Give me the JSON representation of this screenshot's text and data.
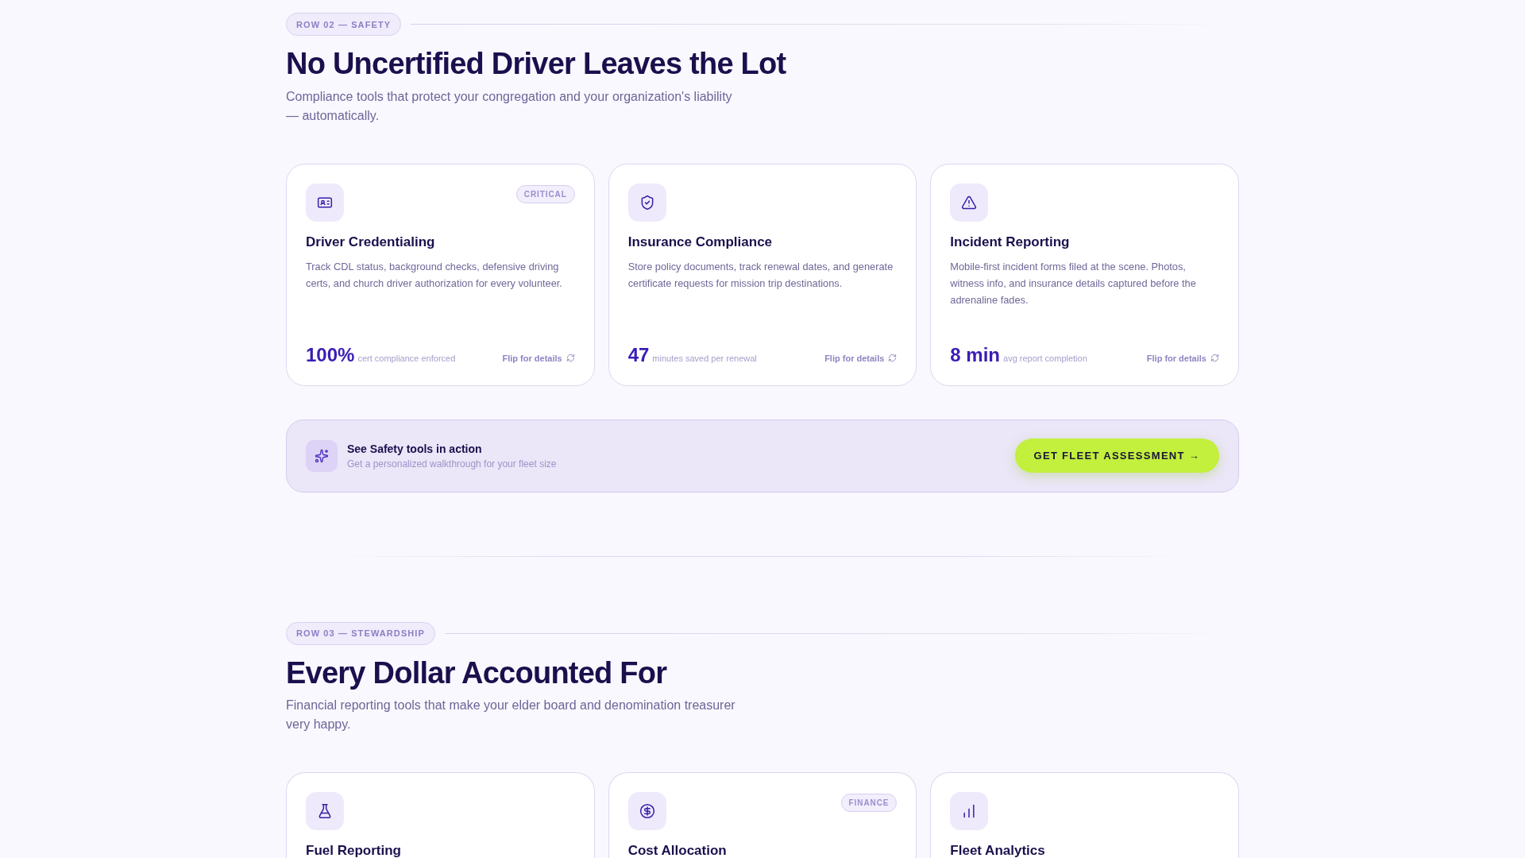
{
  "sections": [
    {
      "tag": "ROW 02 — SAFETY",
      "title": "No Uncertified Driver Leaves the Lot",
      "subtitle": "Compliance tools that protect your congregation and your organization's liability — automatically.",
      "cards": [
        {
          "title": "Driver Credentialing",
          "badge": "CRITICAL",
          "description": "Track CDL status, background checks, defensive driving certs, and church driver authorization for every volunteer.",
          "stat_value": "100%",
          "stat_label": "cert compliance enforced",
          "flip": "Flip for details"
        },
        {
          "title": "Insurance Compliance",
          "description": "Store policy documents, track renewal dates, and generate certificate requests for mission trip destinations.",
          "stat_value": "47",
          "stat_label": "minutes saved per renewal",
          "flip": "Flip for details"
        },
        {
          "title": "Incident Reporting",
          "description": "Mobile-first incident forms filed at the scene. Photos, witness info, and insurance details captured before the adrenaline fades.",
          "stat_value": "8 min",
          "stat_label": "avg report completion",
          "flip": "Flip for details"
        }
      ],
      "cta": {
        "title": "See Safety tools in action",
        "subtitle": "Get a personalized walkthrough for your fleet size",
        "button": "GET FLEET ASSESSMENT →"
      }
    },
    {
      "tag": "ROW 03 — STEWARDSHIP",
      "title": "Every Dollar Accounted For",
      "subtitle": "Financial reporting tools that make your elder board and denomination treasurer very happy.",
      "cards": [
        {
          "title": "Fuel Reporting"
        },
        {
          "title": "Cost Allocation",
          "badge": "FINANCE"
        },
        {
          "title": "Fleet Analytics"
        }
      ]
    }
  ]
}
